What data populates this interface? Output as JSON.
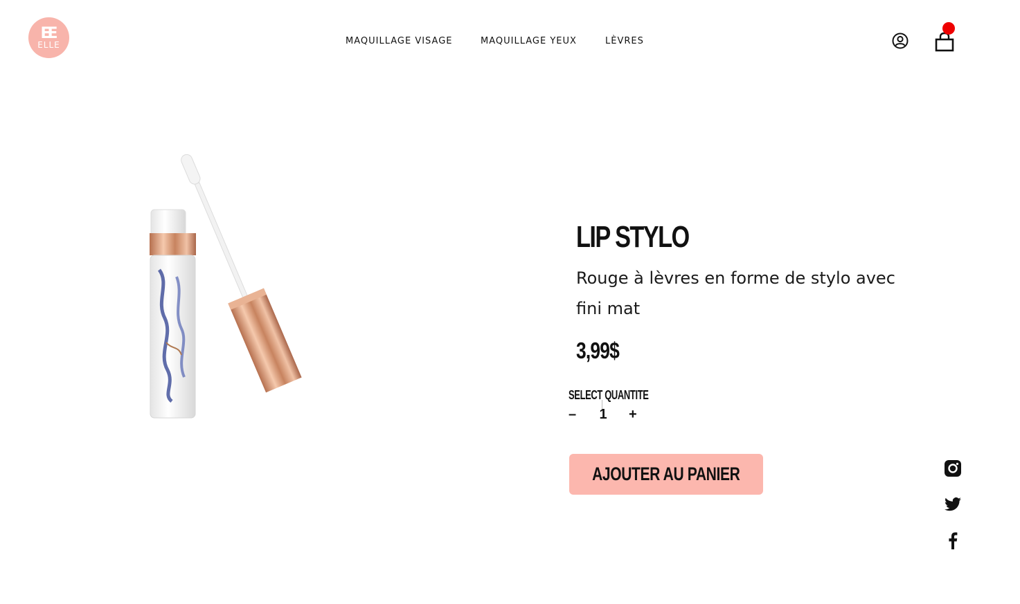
{
  "brand": {
    "logo_mark": "EE",
    "logo_text": "ELLE",
    "logo_color": "#f8b4ab"
  },
  "nav": {
    "items": [
      {
        "label": "MAQUILLAGE VISAGE"
      },
      {
        "label": "MAQUILLAGE YEUX"
      },
      {
        "label": "LÈVRES"
      }
    ]
  },
  "header_icons": {
    "user": "user-circle-icon",
    "cart": "shopping-bag-icon",
    "cart_badge_color": "#ee0000"
  },
  "product": {
    "title": "LIP STYLO",
    "description": "Rouge à lèvres en forme de stylo avec fini mat",
    "price": "3,99$",
    "quantity_label": "SELECT QUANTITE",
    "quantity_minus": "–",
    "quantity_value": "1",
    "quantity_plus": "+",
    "add_to_cart_label": "AJOUTER AU PANIER",
    "button_color": "#fcb7ae"
  },
  "social": [
    {
      "icon": "instagram-icon"
    },
    {
      "icon": "twitter-icon"
    },
    {
      "icon": "facebook-icon"
    }
  ]
}
